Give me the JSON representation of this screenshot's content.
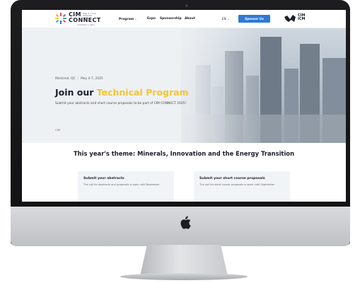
{
  "nav": {
    "brand_top": "CIM",
    "brand_sub": "May 4–7 mai Montréal 2025",
    "brand_bottom": "CONNECT",
    "brand_tag": "convention + expo",
    "links": [
      {
        "label": "Program",
        "has_dropdown": true
      },
      {
        "label": "Expo",
        "has_dropdown": false
      },
      {
        "label": "Sponsorship",
        "has_dropdown": false
      },
      {
        "label": "About",
        "has_dropdown": false
      }
    ],
    "language": "EN",
    "sponsor_button": "Sponsor Us",
    "org_logo_line1": "CIM",
    "org_logo_line2": "ICM"
  },
  "hero": {
    "location": "Montreal, QC",
    "dates": "May 4-7, 2025",
    "title_plain": "Join our",
    "title_accent": "Technical Program",
    "description": "Submit your abstracts and short course proposals to be part of CIM CONNECT 2025!",
    "tag": "CIM"
  },
  "theme": {
    "title": "This year's theme: Minerals, Innovation and the Energy Transition",
    "cards": [
      {
        "title": "Submit your abstracts",
        "body": "The call for abstracts and proposals is open until November"
      },
      {
        "title": "Submit your short course proposals",
        "body": "The call for short course proposals is open until September"
      }
    ]
  },
  "colors": {
    "accent": "#f5c52e",
    "primary_button": "#2d7ad6",
    "dark_text": "#1c1e2b",
    "hero_bg": "#eef1f4"
  },
  "icons": {
    "brand": "cim-connect-burst-icon",
    "org": "cim-icm-logo-icon",
    "device": "apple-icon"
  }
}
